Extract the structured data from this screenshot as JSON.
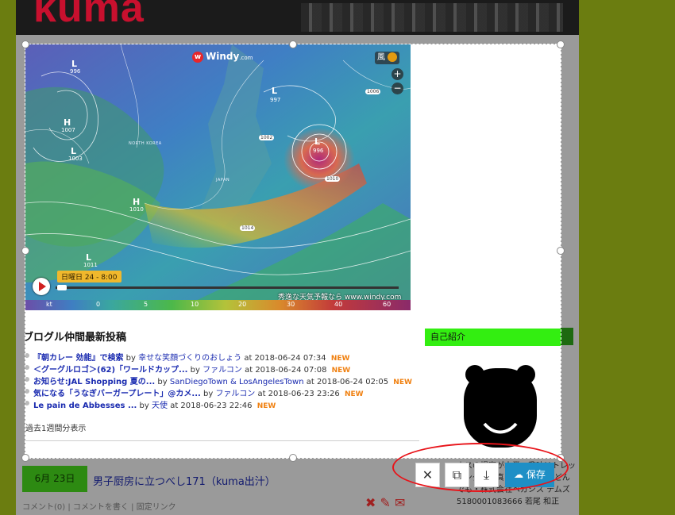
{
  "blog": {
    "banner_logo": "kuma",
    "entry_date": "6月 23日",
    "entry_title": "男子厨房に立つべし171（kuma出汁）",
    "entry_meta": "コメント(0) | コメントを書く | 固定リンク",
    "profile_text": "ネスの提案が本業。趣味はトレッキング・写真 音楽・料理などんでも・株式会社ベガシス テムズ 5180001083666 若尾 和正"
  },
  "map": {
    "brand": "Windy",
    "brand_suffix": ".com",
    "layer_label": "風",
    "zoom_in": "+",
    "zoom_out": "−",
    "date_tag": "日曜日 24 - 8:00",
    "credit": "秀逸な天気予報なら www.windy.com",
    "scale_unit": "kt",
    "scale_ticks": [
      "0",
      "5",
      "10",
      "20",
      "30",
      "40",
      "60"
    ],
    "pressure_labels": [
      "996",
      "1007",
      "1003",
      "1010",
      "1011",
      "997",
      "1006",
      "1002",
      "996",
      "1010",
      "1014"
    ],
    "region_labels": [
      "NORTH KOREA",
      "JAPAN"
    ],
    "low_markers": [
      "L",
      "L",
      "L",
      "L",
      "L"
    ],
    "high_markers": [
      "H",
      "H"
    ]
  },
  "friends": {
    "title": "ブログル仲間最新投稿",
    "posts": [
      {
        "title": "『朝カレー 効能』で検索",
        "by": "by",
        "author": "幸せな笑顔づくりのおしょう",
        "at": "at 2018-06-24 07:34",
        "new": "NEW"
      },
      {
        "title": "＜グーグルロゴ＞(62)「ワールドカップ...",
        "by": "by",
        "author": "ファルコン",
        "at": "at 2018-06-24 07:08",
        "new": "NEW"
      },
      {
        "title": "お知らせ:JAL Shopping 夏の...",
        "by": "by",
        "author": "SanDiegoTown & LosAngelesTown",
        "at": "at 2018-06-24 02:05",
        "new": "NEW"
      },
      {
        "title": "気になる「うなぎバーガープレート」@カメ...",
        "by": "by",
        "author": "ファルコン",
        "at": "at 2018-06-23 23:26",
        "new": "NEW"
      },
      {
        "title": "Le pain de Abbesses ...",
        "by": "by",
        "author": "天使",
        "at": "at 2018-06-23 22:46",
        "new": "NEW"
      }
    ],
    "week_link": "過去1週間分表示"
  },
  "profile": {
    "title": "自己紹介"
  },
  "toolbar": {
    "close_glyph": "✕",
    "copy_glyph": "⧉",
    "download_glyph": "⤓",
    "save_label": "保存",
    "save_glyph": "☁"
  },
  "colors": {
    "save_button": "#1e8fc6",
    "highlight": "#e8141a",
    "profile_header": "#33ee11",
    "new_badge": "#f08010"
  },
  "icons": {
    "close": "close-icon",
    "copy": "copy-icon",
    "download": "download-icon",
    "save": "cloud-upload-icon"
  }
}
